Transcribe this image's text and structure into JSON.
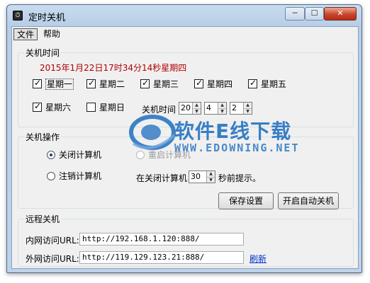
{
  "window": {
    "title": "定时关机",
    "icon": "app-icon",
    "controls": {
      "minimize": "─",
      "maximize": "☐",
      "close": "✕"
    }
  },
  "menu": {
    "items": [
      "文件",
      "帮助"
    ]
  },
  "shutdown_time": {
    "legend": "关机时间",
    "datetime": "2015年1月22日17时34分14秒星期四",
    "weekdays": [
      {
        "label": "星期一",
        "checked": true
      },
      {
        "label": "星期二",
        "checked": true
      },
      {
        "label": "星期三",
        "checked": true
      },
      {
        "label": "星期四",
        "checked": true
      },
      {
        "label": "星期五",
        "checked": true
      },
      {
        "label": "星期六",
        "checked": true
      },
      {
        "label": "星期日",
        "checked": false
      }
    ],
    "time_label": "关机时间",
    "hour": "20",
    "minute": "4",
    "second": "2"
  },
  "shutdown_action": {
    "legend": "关机操作",
    "options": [
      {
        "label": "关闭计算机",
        "selected": true,
        "enabled": true
      },
      {
        "label": "重启计算机",
        "selected": false,
        "enabled": false
      },
      {
        "label": "注销计算机",
        "selected": false,
        "enabled": true
      }
    ],
    "reminder_prefix": "在关闭计算机",
    "reminder_seconds": "30",
    "reminder_suffix": "秒前提示。",
    "save_button": "保存设置",
    "start_button": "开启自动关机"
  },
  "remote": {
    "legend": "远程关机",
    "lan_label": "内网访问URL:",
    "lan_url": "http://192.168.1.120:888/",
    "wan_label": "外网访问URL:",
    "wan_url": "http://119.129.123.21:888/",
    "refresh_link": "刷新"
  },
  "watermark": {
    "title": "软件E线下载",
    "url": "WWW.EDOWNING.NET"
  },
  "colors": {
    "datetime_text": "#b00000",
    "link": "#0033cc",
    "close_button": "#c8452c",
    "watermark": "#1e6ebe"
  }
}
